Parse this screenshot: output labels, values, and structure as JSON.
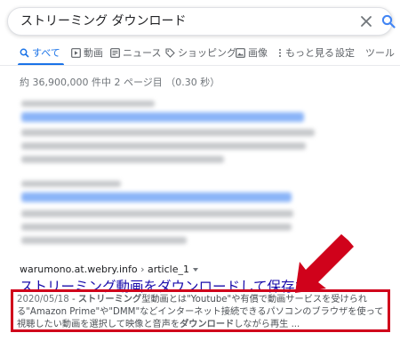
{
  "search": {
    "query": "ストリーミング ダウンロード"
  },
  "tabs": [
    {
      "label": "すべて",
      "icon": "search-icon",
      "active": true
    },
    {
      "label": "動画",
      "icon": "video-icon"
    },
    {
      "label": "ニュース",
      "icon": "news-icon"
    },
    {
      "label": "ショッピング",
      "icon": "tag-icon"
    },
    {
      "label": "画像",
      "icon": "image-icon"
    },
    {
      "label": "もっと見る",
      "icon": "more-vert-icon"
    },
    {
      "label": "設定"
    },
    {
      "label": "ツール"
    }
  ],
  "stats": "約 36,900,000 件中 2 ページ目 （0.30 秒）",
  "result": {
    "cite_host": "warumono.at.webry.info",
    "cite_path": "article_1",
    "title": "ストリーミング動画をダウンロードして保存する ...",
    "date": "2020/05/18",
    "snippet_parts": [
      " - ",
      "ストリーミング",
      "型動画とは\"Youtube\"や有償で動画サービスを受けられる\"Amazon Prime\"や\"DMM\"などインターネット接続できるパソコンのブラウザを使って視聴したい動画を選択して映像と音声を",
      "ダウンロード",
      "しながら再生 ..."
    ]
  },
  "colors": {
    "link": "#1a0dab",
    "accent": "#1a73e8",
    "highlight_border": "#d0021b",
    "arrow": "#d0021b"
  }
}
